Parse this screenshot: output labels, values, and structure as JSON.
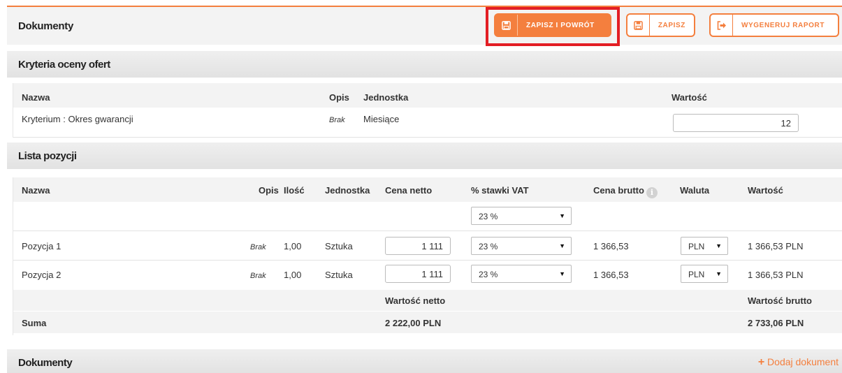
{
  "header": {
    "title": "Dokumenty",
    "buttons": {
      "save_return": "ZAPISZ I POWRÓT",
      "save": "ZAPISZ",
      "report": "WYGENERUJ RAPORT"
    }
  },
  "criteria": {
    "title": "Kryteria oceny ofert",
    "columns": {
      "name": "Nazwa",
      "desc": "Opis",
      "unit": "Jednostka",
      "value": "Wartość"
    },
    "rows": [
      {
        "name": "Kryterium : Okres gwarancji",
        "desc": "Brak",
        "unit": "Miesiące",
        "value": "12"
      }
    ]
  },
  "positions": {
    "title": "Lista pozycji",
    "columns": {
      "name": "Nazwa",
      "desc": "Opis",
      "qty": "Ilość",
      "unit": "Jednostka",
      "net_price": "Cena netto",
      "vat": "% stawki VAT",
      "gross_price": "Cena brutto",
      "currency": "Waluta",
      "value": "Wartość"
    },
    "bulk_vat": "23 %",
    "rows": [
      {
        "name": "Pozycja 1",
        "desc": "Brak",
        "qty": "1,00",
        "unit": "Sztuka",
        "net_price": "1 111",
        "vat": "23 %",
        "gross_price": "1 366,53",
        "currency": "PLN",
        "value": "1 366,53 PLN"
      },
      {
        "name": "Pozycja 2",
        "desc": "Brak",
        "qty": "1,00",
        "unit": "Sztuka",
        "net_price": "1 111",
        "vat": "23 %",
        "gross_price": "1 366,53",
        "currency": "PLN",
        "value": "1 366,53 PLN"
      }
    ],
    "summary": {
      "net_label": "Wartość netto",
      "gross_label": "Wartość brutto",
      "sum_label": "Suma",
      "net_total": "2 222,00 PLN",
      "gross_total": "2 733,06 PLN"
    }
  },
  "documents": {
    "title": "Dokumenty",
    "add_label": "Dodaj dokument"
  },
  "colors": {
    "accent": "#f47f3e",
    "highlight": "#e31e24"
  }
}
